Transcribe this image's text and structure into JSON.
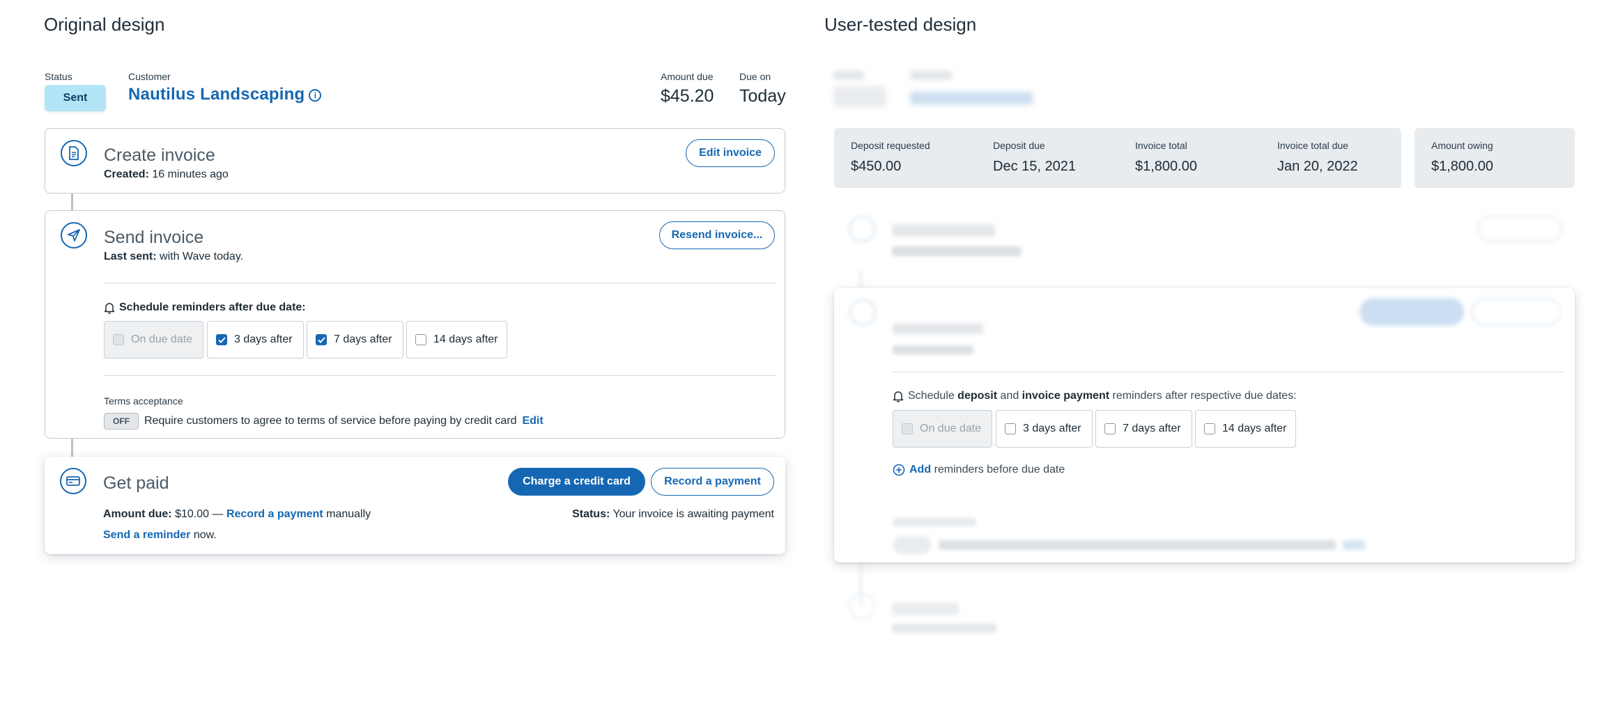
{
  "headings": {
    "original": "Original design",
    "tested": "User-tested design"
  },
  "original": {
    "header": {
      "status_label": "Status",
      "status_value": "Sent",
      "customer_label": "Customer",
      "customer_name": "Nautilus Landscaping",
      "amount_due_label": "Amount due",
      "amount_due_value": "$45.20",
      "due_on_label": "Due on",
      "due_on_value": "Today"
    },
    "create": {
      "title": "Create invoice",
      "meta_label": "Created:",
      "meta_value": "16 minutes ago",
      "button": "Edit invoice"
    },
    "send": {
      "title": "Send invoice",
      "meta_label": "Last sent:",
      "meta_value": "with Wave today.",
      "button": "Resend invoice...",
      "reminders_title": "Schedule reminders after due date:",
      "options": [
        "On due date",
        "3 days after",
        "7 days after",
        "14 days after"
      ],
      "terms_label": "Terms acceptance",
      "terms_toggle": "OFF",
      "terms_text": "Require customers to agree to terms of service before paying by credit card",
      "terms_edit": "Edit"
    },
    "paid": {
      "title": "Get paid",
      "charge_button": "Charge a credit card",
      "record_button": "Record a payment",
      "amount_label": "Amount due:",
      "amount_value": "$10.00 —",
      "record_link": "Record a payment",
      "manually": "manually",
      "reminder_link": "Send a reminder",
      "reminder_suffix": "now.",
      "status_label": "Status:",
      "status_value": "Your invoice is awaiting payment"
    }
  },
  "tested": {
    "summary": [
      {
        "label": "Deposit requested",
        "value": "$450.00"
      },
      {
        "label": "Deposit due",
        "value": "Dec 15, 2021"
      },
      {
        "label": "Invoice total",
        "value": "$1,800.00"
      },
      {
        "label": "Invoice total due",
        "value": "Jan 20, 2022"
      }
    ],
    "owing": {
      "label": "Amount owing",
      "value": "$1,800.00"
    },
    "reminders": {
      "prefix": "Schedule",
      "deposit": "deposit",
      "and": "and",
      "invoice_payment": "invoice payment",
      "suffix": "reminders after respective due dates:",
      "options": [
        "On due date",
        "3 days after",
        "7 days after",
        "14 days after"
      ],
      "add_link": "Add",
      "add_suffix": "reminders before due date"
    }
  },
  "colors": {
    "accent": "#1667b3",
    "status_pill": "#b4e5f7",
    "summary_bg": "#e8ecef"
  }
}
